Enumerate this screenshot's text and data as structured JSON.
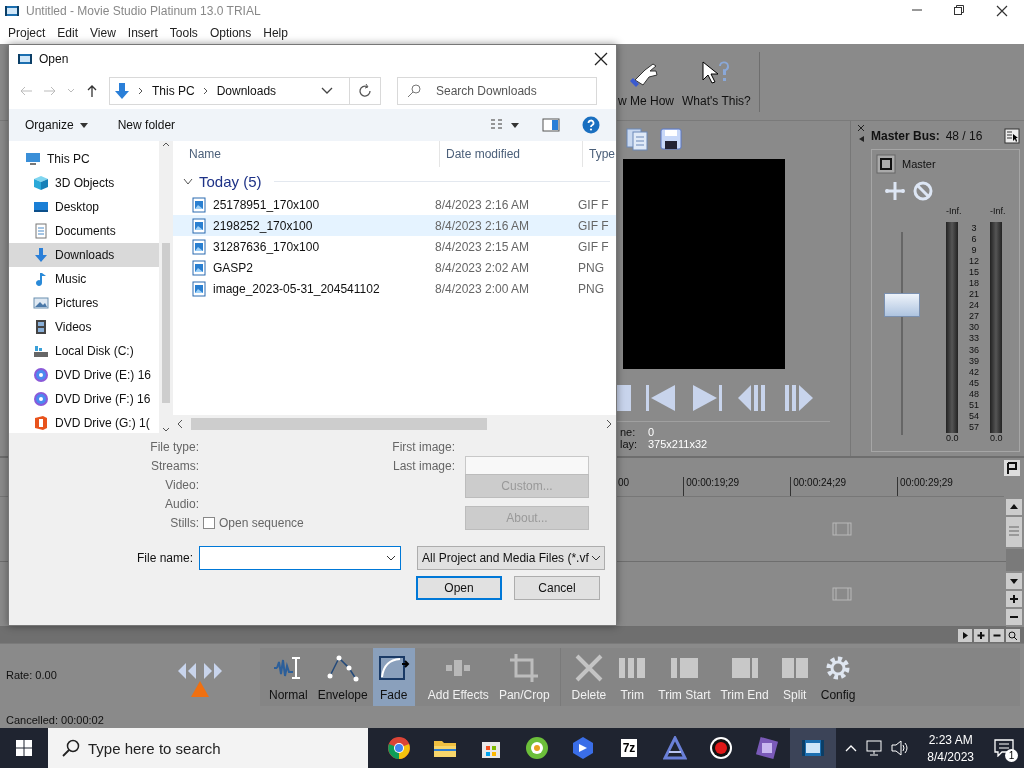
{
  "app": {
    "title": "Untitled - Movie Studio Platinum 13.0 TRIAL",
    "menu": [
      "Project",
      "Edit",
      "View",
      "Insert",
      "Tools",
      "Options",
      "Help"
    ],
    "toolbar": [
      {
        "kind": "hand",
        "label": "w Me How"
      },
      {
        "kind": "help",
        "label": "What's This?"
      }
    ],
    "preview": {
      "info": [
        {
          "label": "ne:",
          "value": "0"
        },
        {
          "label": "lay:",
          "value": "375x211x32"
        }
      ]
    },
    "mixer": {
      "title": "Master Bus:",
      "value": "48 / 16",
      "channel": "Master",
      "peaks": [
        "-Inf.",
        "-Inf."
      ],
      "scale": [
        "3",
        "6",
        "9",
        "12",
        "15",
        "18",
        "21",
        "24",
        "27",
        "30",
        "33",
        "36",
        "39",
        "42",
        "45",
        "48",
        "51",
        "54",
        "57"
      ],
      "readings": [
        "0.0",
        "0.0"
      ],
      "fader": {
        "level": 0.64
      }
    },
    "timeline": {
      "ruler": [
        "00",
        "00:00:19;29",
        "00:00:24;29",
        "00:00:29;29"
      ]
    },
    "status": {
      "rate": "Rate: 0.00",
      "cancelled": "Cancelled: 00:00:02"
    },
    "edit_tools": [
      {
        "kind": "normal",
        "label": "Normal",
        "selected": false,
        "disabled": false
      },
      {
        "kind": "envelope",
        "label": "Envelope",
        "selected": false,
        "disabled": false
      },
      {
        "kind": "fade",
        "label": "Fade",
        "selected": true,
        "disabled": false
      },
      {
        "kind": "effects",
        "label": "Add Effects",
        "selected": false,
        "disabled": true
      },
      {
        "kind": "crop",
        "label": "Pan/Crop",
        "selected": false,
        "disabled": true
      },
      {
        "kind": "delete",
        "label": "Delete",
        "selected": false,
        "disabled": true
      },
      {
        "kind": "trim",
        "label": "Trim",
        "selected": false,
        "disabled": true
      },
      {
        "kind": "trimstart",
        "label": "Trim Start",
        "selected": false,
        "disabled": true
      },
      {
        "kind": "trimend",
        "label": "Trim End",
        "selected": false,
        "disabled": true
      },
      {
        "kind": "split",
        "label": "Split",
        "selected": false,
        "disabled": true
      },
      {
        "kind": "config",
        "label": "Config",
        "selected": false,
        "disabled": false
      }
    ]
  },
  "dialog": {
    "title": "Open",
    "path": [
      "This PC",
      "Downloads"
    ],
    "search": {
      "placeholder": "Search Downloads"
    },
    "commands": [
      "Organize",
      "New folder"
    ],
    "nav": [
      {
        "kind": "pc",
        "label": "This PC",
        "selected": false
      },
      {
        "kind": "objects",
        "label": "3D Objects",
        "selected": false
      },
      {
        "kind": "desktop",
        "label": "Desktop",
        "selected": false
      },
      {
        "kind": "documents",
        "label": "Documents",
        "selected": false
      },
      {
        "kind": "downloads",
        "label": "Downloads",
        "selected": true
      },
      {
        "kind": "music",
        "label": "Music",
        "selected": false
      },
      {
        "kind": "pictures",
        "label": "Pictures",
        "selected": false
      },
      {
        "kind": "videos",
        "label": "Videos",
        "selected": false
      },
      {
        "kind": "disk",
        "label": "Local Disk (C:)",
        "selected": false
      },
      {
        "kind": "dvd",
        "label": "DVD Drive (E:) 16",
        "selected": false
      },
      {
        "kind": "dvd",
        "label": "DVD Drive (F:) 16",
        "selected": false
      },
      {
        "kind": "office",
        "label": "DVD Drive (G:) 1(",
        "selected": false
      }
    ],
    "columns": [
      "Name",
      "Date modified",
      "Type"
    ],
    "group": "Today (5)",
    "files": [
      {
        "name": "25178951_170x100",
        "date": "8/4/2023 2:16 AM",
        "type": "GIF F",
        "hovered": false
      },
      {
        "name": "2198252_170x100",
        "date": "8/4/2023 2:16 AM",
        "type": "GIF F",
        "hovered": true
      },
      {
        "name": "31287636_170x100",
        "date": "8/4/2023 2:15 AM",
        "type": "GIF F",
        "hovered": false
      },
      {
        "name": "GASP2",
        "date": "8/4/2023 2:02 AM",
        "type": "PNG",
        "hovered": false
      },
      {
        "name": "image_2023-05-31_204541102",
        "date": "8/4/2023 2:00 AM",
        "type": "PNG",
        "hovered": false
      }
    ],
    "info_labels": [
      "File type:",
      "Streams:",
      "Video:",
      "Audio:"
    ],
    "stills": {
      "label": "Stills:",
      "option": "Open sequence",
      "checked": false
    },
    "image_labels": [
      "First image:",
      "Last image:"
    ],
    "side_buttons": [
      {
        "label": "Custom...",
        "disabled": true
      },
      {
        "label": "About...",
        "disabled": true
      }
    ],
    "file_name": {
      "label": "File name:"
    },
    "filter": "All Project and Media Files (*.vf",
    "buttons": [
      {
        "label": "Open",
        "default": true
      },
      {
        "label": "Cancel",
        "default": false
      }
    ]
  },
  "taskbar": {
    "search": {
      "placeholder": "Type here to search"
    },
    "apps": [
      {
        "kind": "browser",
        "selected": false
      },
      {
        "kind": "folder",
        "selected": false
      },
      {
        "kind": "store",
        "selected": false
      },
      {
        "kind": "green",
        "selected": false
      },
      {
        "kind": "blue",
        "selected": false
      },
      {
        "kind": "archive",
        "label": "7z",
        "selected": false
      },
      {
        "kind": "letter",
        "selected": false
      },
      {
        "kind": "record",
        "selected": false
      },
      {
        "kind": "purple",
        "selected": false
      },
      {
        "kind": "film",
        "selected": true
      }
    ],
    "time": "2:23 AM",
    "date": "8/4/2023",
    "notifications": "1"
  }
}
